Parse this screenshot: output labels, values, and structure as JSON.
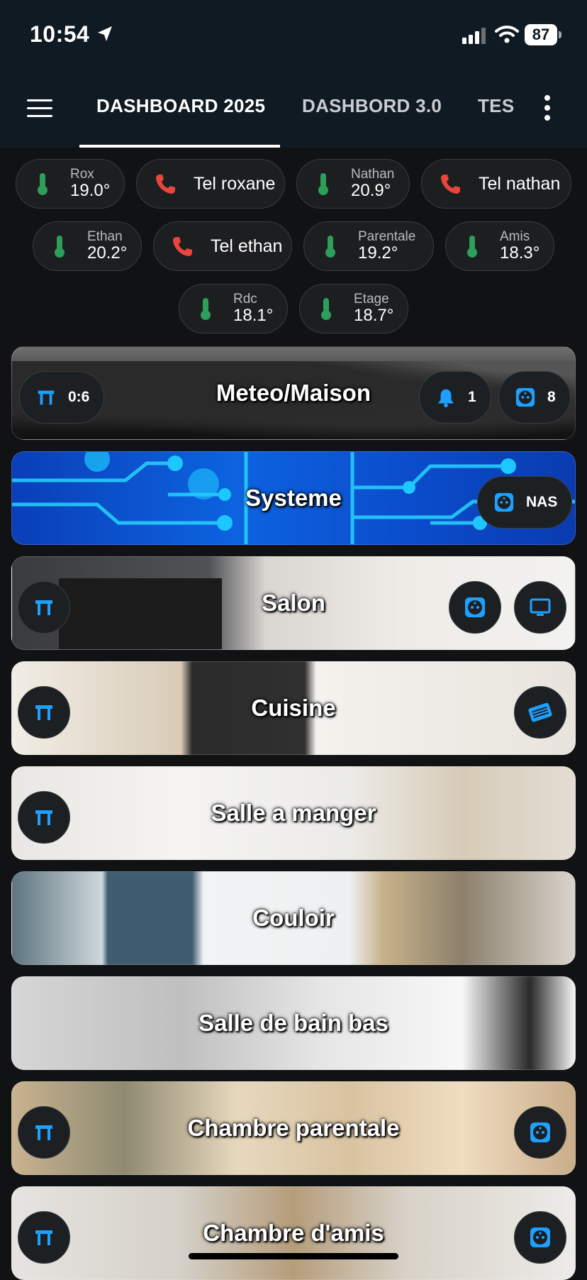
{
  "status_bar": {
    "time": "10:54",
    "battery": "87"
  },
  "tabs": [
    {
      "label": "DASHBOARD 2025",
      "active": true
    },
    {
      "label": "DASHBORD 3.0",
      "active": false
    },
    {
      "label": "TES",
      "active": false
    }
  ],
  "chips": {
    "rox": {
      "label": "Rox",
      "value": "19.0°"
    },
    "tel_roxane": {
      "label": "Tel roxane"
    },
    "nathan": {
      "label": "Nathan",
      "value": "20.9°"
    },
    "tel_nathan": {
      "label": "Tel nathan"
    },
    "ethan": {
      "label": "Ethan",
      "value": "20.2°"
    },
    "tel_ethan": {
      "label": "Tel ethan"
    },
    "parentale": {
      "label": "Parentale",
      "value": "19.2°"
    },
    "amis": {
      "label": "Amis",
      "value": "18.3°"
    },
    "rdc": {
      "label": "Rdc",
      "value": "18.1°"
    },
    "etage": {
      "label": "Etage",
      "value": "18.7°"
    }
  },
  "colors": {
    "accent": "#1ea0ff",
    "thermometer": "#2e9e5b",
    "phone": "#e8453c"
  },
  "rooms": {
    "meteo": {
      "title": "Meteo/Maison",
      "stool_count": "0:6",
      "bell_count": "1",
      "socket_count": "8"
    },
    "systeme": {
      "title": "Systeme",
      "nas_label": "NAS"
    },
    "salon": {
      "title": "Salon"
    },
    "cuisine": {
      "title": "Cuisine"
    },
    "salle_a_manger": {
      "title": "Salle a manger"
    },
    "couloir": {
      "title": "Couloir"
    },
    "salle_de_bain_bas": {
      "title": "Salle de bain bas"
    },
    "chambre_parentale": {
      "title": "Chambre parentale"
    },
    "chambre_amis": {
      "title": "Chambre d'amis"
    }
  }
}
